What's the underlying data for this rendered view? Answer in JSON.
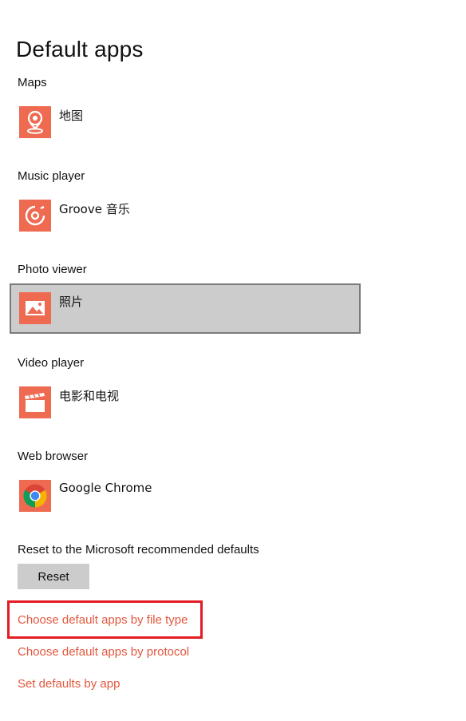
{
  "page": {
    "title": "Default apps"
  },
  "sections": [
    {
      "label": "Maps",
      "app_name": "地图",
      "icon": "map-pin-icon"
    },
    {
      "label": "Music player",
      "app_name": "Groove 音乐",
      "icon": "groove-music-icon"
    },
    {
      "label": "Photo viewer",
      "app_name": "照片",
      "icon": "photos-icon",
      "selected": true
    },
    {
      "label": "Video player",
      "app_name": "电影和电视",
      "icon": "clapperboard-icon"
    },
    {
      "label": "Web browser",
      "app_name": "Google Chrome",
      "icon": "chrome-icon"
    }
  ],
  "reset": {
    "label": "Reset to the Microsoft recommended defaults",
    "button_label": "Reset"
  },
  "links": {
    "by_file_type": "Choose default apps by file type",
    "by_protocol": "Choose default apps by protocol",
    "by_app": "Set defaults by app"
  },
  "colors": {
    "accent": "#e2583e",
    "tile_icon_bg": "#ee6a50",
    "selected_bg": "#cccccc",
    "highlight": "#e31b23"
  }
}
